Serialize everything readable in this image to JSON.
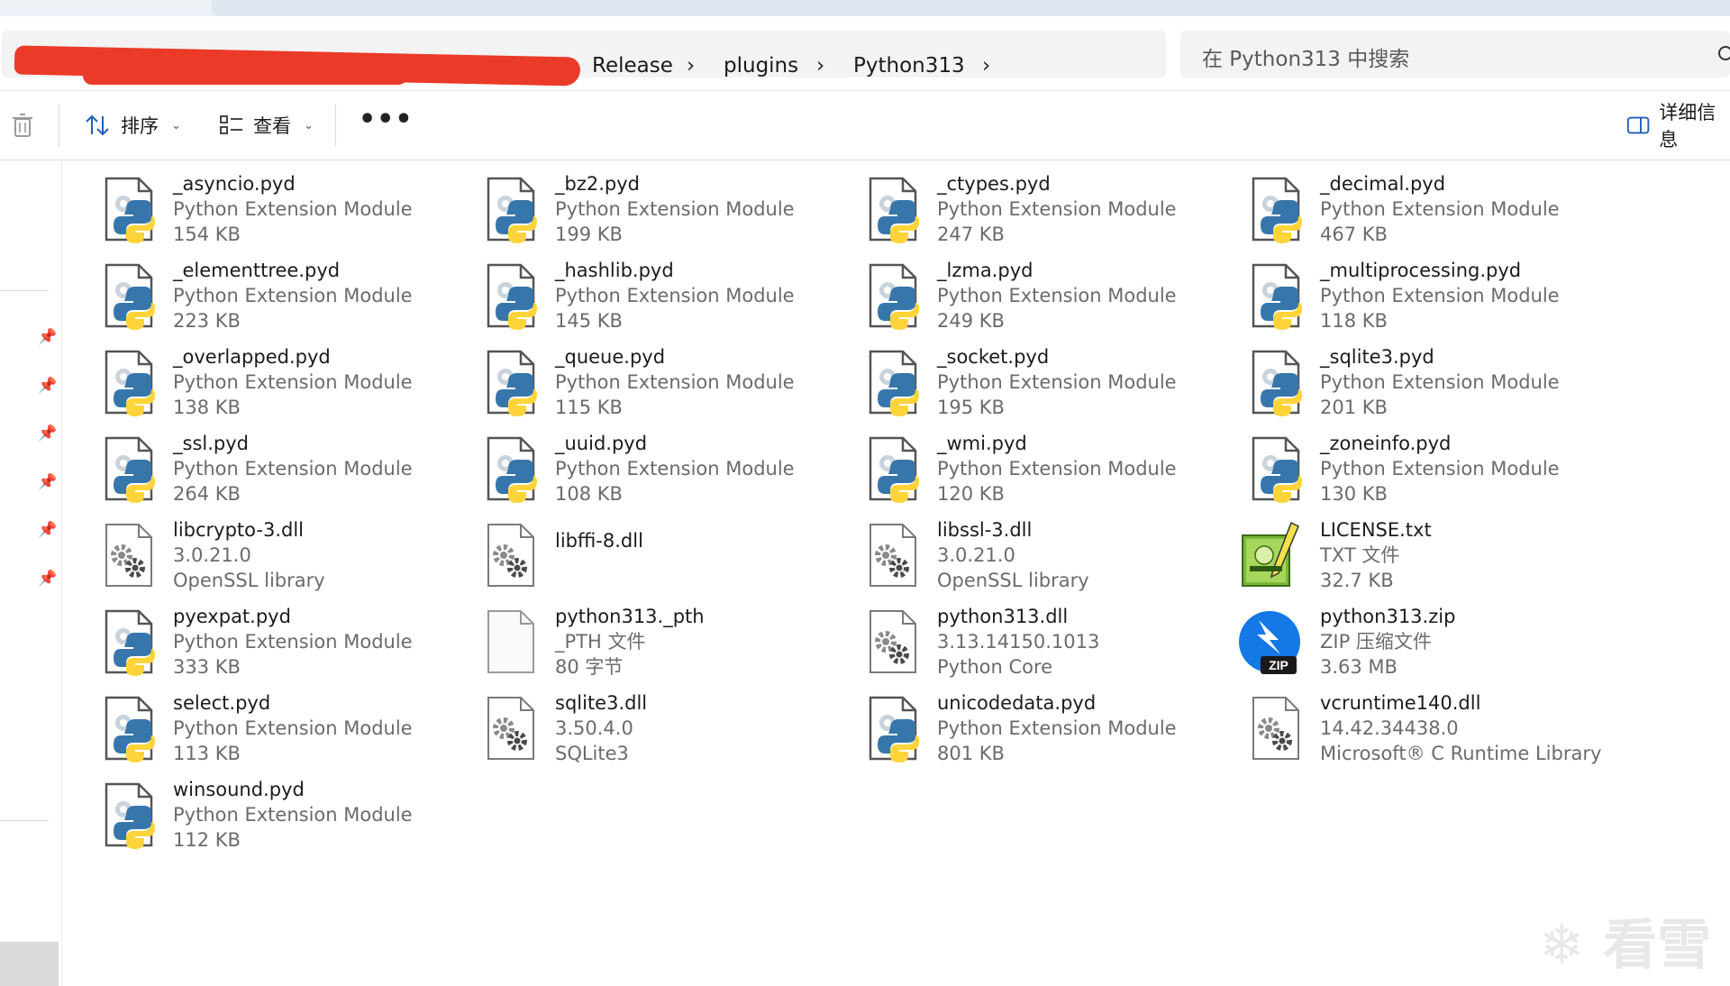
{
  "breadcrumb": {
    "items": [
      "Release",
      "plugins",
      "Python313"
    ]
  },
  "search": {
    "placeholder": "在 Python313 中搜索"
  },
  "toolbar": {
    "sort_label": "排序",
    "view_label": "查看",
    "more_label": "•••",
    "details_label": "详细信息"
  },
  "files": [
    {
      "name": "_asyncio.pyd",
      "type": "Python Extension Module",
      "size": "154 KB",
      "icon": "python-icon"
    },
    {
      "name": "_bz2.pyd",
      "type": "Python Extension Module",
      "size": "199 KB",
      "icon": "python-icon"
    },
    {
      "name": "_ctypes.pyd",
      "type": "Python Extension Module",
      "size": "247 KB",
      "icon": "python-icon"
    },
    {
      "name": "_decimal.pyd",
      "type": "Python Extension Module",
      "size": "467 KB",
      "icon": "python-icon"
    },
    {
      "name": "_elementtree.pyd",
      "type": "Python Extension Module",
      "size": "223 KB",
      "icon": "python-icon"
    },
    {
      "name": "_hashlib.pyd",
      "type": "Python Extension Module",
      "size": "145 KB",
      "icon": "python-icon"
    },
    {
      "name": "_lzma.pyd",
      "type": "Python Extension Module",
      "size": "249 KB",
      "icon": "python-icon"
    },
    {
      "name": "_multiprocessing.pyd",
      "type": "Python Extension Module",
      "size": "118 KB",
      "icon": "python-icon"
    },
    {
      "name": "_overlapped.pyd",
      "type": "Python Extension Module",
      "size": "138 KB",
      "icon": "python-icon"
    },
    {
      "name": "_queue.pyd",
      "type": "Python Extension Module",
      "size": "115 KB",
      "icon": "python-icon"
    },
    {
      "name": "_socket.pyd",
      "type": "Python Extension Module",
      "size": "195 KB",
      "icon": "python-icon"
    },
    {
      "name": "_sqlite3.pyd",
      "type": "Python Extension Module",
      "size": "201 KB",
      "icon": "python-icon"
    },
    {
      "name": "_ssl.pyd",
      "type": "Python Extension Module",
      "size": "264 KB",
      "icon": "python-icon"
    },
    {
      "name": "_uuid.pyd",
      "type": "Python Extension Module",
      "size": "108 KB",
      "icon": "python-icon"
    },
    {
      "name": "_wmi.pyd",
      "type": "Python Extension Module",
      "size": "120 KB",
      "icon": "python-icon"
    },
    {
      "name": "_zoneinfo.pyd",
      "type": "Python Extension Module",
      "size": "130 KB",
      "icon": "python-icon"
    },
    {
      "name": "libcrypto-3.dll",
      "type": "3.0.21.0",
      "size": "OpenSSL library",
      "icon": "dll-gear-icon"
    },
    {
      "name": "libffi-8.dll",
      "type": "",
      "size": "",
      "icon": "dll-gear-icon"
    },
    {
      "name": "libssl-3.dll",
      "type": "3.0.21.0",
      "size": "OpenSSL library",
      "icon": "dll-gear-icon"
    },
    {
      "name": "LICENSE.txt",
      "type": "TXT 文件",
      "size": "32.7 KB",
      "icon": "notepad-icon"
    },
    {
      "name": "pyexpat.pyd",
      "type": "Python Extension Module",
      "size": "333 KB",
      "icon": "python-icon"
    },
    {
      "name": "python313._pth",
      "type": "_PTH 文件",
      "size": "80 字节",
      "icon": "blank-file-icon"
    },
    {
      "name": "python313.dll",
      "type": "3.13.14150.1013",
      "size": "Python Core",
      "icon": "dll-gear-icon"
    },
    {
      "name": "python313.zip",
      "type": "ZIP 压缩文件",
      "size": "3.63 MB",
      "icon": "zip-icon"
    },
    {
      "name": "select.pyd",
      "type": "Python Extension Module",
      "size": "113 KB",
      "icon": "python-icon"
    },
    {
      "name": "sqlite3.dll",
      "type": "3.50.4.0",
      "size": "SQLite3",
      "icon": "dll-gear-icon"
    },
    {
      "name": "unicodedata.pyd",
      "type": "Python Extension Module",
      "size": "801 KB",
      "icon": "python-icon"
    },
    {
      "name": "vcruntime140.dll",
      "type": "14.42.34438.0",
      "size": "Microsoft® C Runtime Library",
      "icon": "dll-gear-icon"
    },
    {
      "name": "winsound.pyd",
      "type": "Python Extension Module",
      "size": "112 KB",
      "icon": "python-icon"
    }
  ],
  "zip_badge": "ZIP",
  "watermark": "看雪",
  "colors": {
    "redaction": "#ea3a28",
    "python_blue": "#3776ab",
    "python_yellow": "#ffd43b",
    "zip_blue": "#1478e6"
  }
}
